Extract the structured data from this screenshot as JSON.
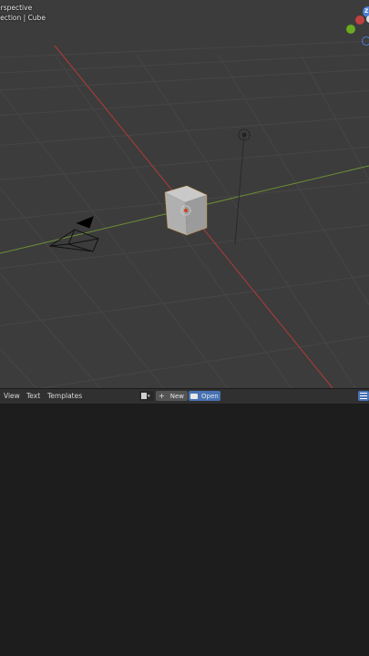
{
  "viewport": {
    "view_name": "erspective",
    "collection_object": "llection | Cube",
    "gizmo": {
      "z_label": "Z"
    }
  },
  "text_editor_header": {
    "menus": {
      "view": "View",
      "text": "Text",
      "templates": "Templates"
    },
    "new_label": "New",
    "open_label": "Open",
    "new_icon": "plus-icon",
    "open_icon": "folder-icon",
    "linenum_icon": "line-numbers-icon"
  },
  "colors": {
    "viewport_bg": "#3c3c3c",
    "x_axis": "#b23a3a",
    "y_axis": "#6d8f33",
    "header_bg": "#303030",
    "accent_blue": "#4772b3",
    "editor_bg": "#1d1d1d"
  }
}
